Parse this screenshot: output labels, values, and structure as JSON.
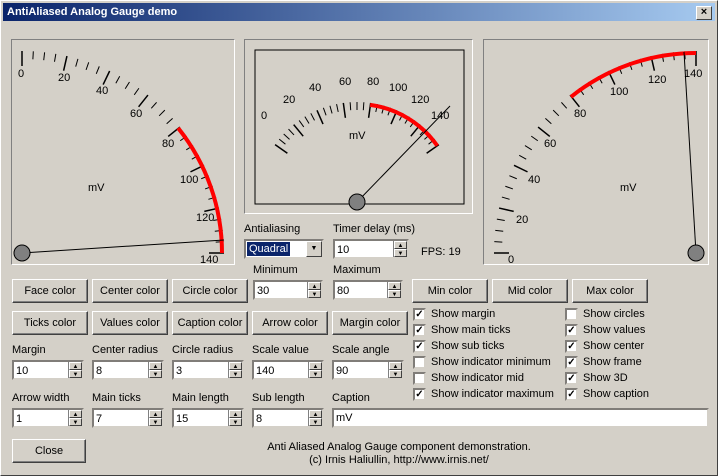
{
  "window": {
    "title": "AntiAliased Analog Gauge demo",
    "close_glyph": "×"
  },
  "gauges": {
    "g1": {
      "caption": "mV",
      "ticks": [
        "0",
        "20",
        "40",
        "60",
        "80",
        "100",
        "120",
        "140"
      ]
    },
    "g2": {
      "caption": "mV",
      "ticks": [
        "0",
        "20",
        "40",
        "60",
        "80",
        "100",
        "120",
        "140"
      ]
    },
    "g3": {
      "caption": "mV",
      "ticks": [
        "0",
        "20",
        "40",
        "60",
        "80",
        "100",
        "120",
        "140"
      ]
    }
  },
  "controls": {
    "antialiasing_label": "Antialiasing",
    "antialiasing_value": "Quadral",
    "timer_label": "Timer delay (ms)",
    "timer_value": "10",
    "fps": "FPS: 19",
    "minimum_label": "Minimum",
    "minimum_value": "30",
    "maximum_label": "Maximum",
    "maximum_value": "80",
    "margin_label": "Margin",
    "margin_value": "10",
    "center_radius_label": "Center radius",
    "center_radius_value": "8",
    "circle_radius_label": "Circle radius",
    "circle_radius_value": "3",
    "scale_value_label": "Scale value",
    "scale_value_value": "140",
    "scale_angle_label": "Scale angle",
    "scale_angle_value": "90",
    "arrow_width_label": "Arrow width",
    "arrow_width_value": "1",
    "main_ticks_label": "Main ticks",
    "main_ticks_value": "7",
    "main_length_label": "Main length",
    "main_length_value": "15",
    "sub_length_label": "Sub length",
    "sub_length_value": "8",
    "caption_label": "Caption",
    "caption_value": "mV"
  },
  "buttons": {
    "face_color": "Face color",
    "center_color": "Center color",
    "circle_color": "Circle color",
    "min_color": "Min color",
    "mid_color": "Mid color",
    "max_color": "Max color",
    "ticks_color": "Ticks color",
    "values_color": "Values color",
    "caption_color": "Caption color",
    "arrow_color": "Arrow color",
    "margin_color": "Margin color",
    "close": "Close"
  },
  "checks": {
    "show_margin": {
      "label": "Show margin",
      "checked": true
    },
    "show_main_ticks": {
      "label": "Show main ticks",
      "checked": true
    },
    "show_sub_ticks": {
      "label": "Show sub ticks",
      "checked": true
    },
    "show_indicator_minimum": {
      "label": "Show indicator minimum",
      "checked": false
    },
    "show_indicator_mid": {
      "label": "Show indicator mid",
      "checked": false
    },
    "show_indicator_maximum": {
      "label": "Show indicator maximum",
      "checked": true
    },
    "show_circles": {
      "label": "Show circles",
      "checked": false
    },
    "show_values": {
      "label": "Show values",
      "checked": true
    },
    "show_center": {
      "label": "Show center",
      "checked": true
    },
    "show_frame": {
      "label": "Show frame",
      "checked": true
    },
    "show_3d": {
      "label": "Show 3D",
      "checked": true
    },
    "show_caption": {
      "label": "Show caption",
      "checked": true
    }
  },
  "footer": {
    "line1": "Anti Aliased Analog Gauge component demonstration.",
    "line2": "(c) Irnis Haliullin, http://www.irnis.net/"
  },
  "colors": {
    "max_arc": "#ff0000",
    "title_start": "#0a246a",
    "title_end": "#a6caf0",
    "face": "#d4d0c8"
  }
}
